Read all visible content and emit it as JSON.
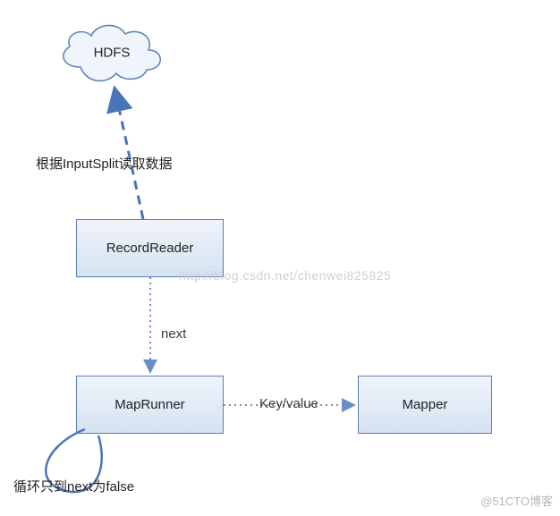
{
  "nodes": {
    "hdfs": "HDFS",
    "record_reader": "RecordReader",
    "map_runner": "MapRunner",
    "mapper": "Mapper"
  },
  "edges": {
    "read_split": "根据InputSplit读取数据",
    "next": "next",
    "key_value": "Key/value",
    "loop_condition": "循环只到next为false"
  },
  "watermarks": {
    "center": "http://blog.csdn.net/chenwei825825",
    "footer": "@51CTO博客"
  }
}
